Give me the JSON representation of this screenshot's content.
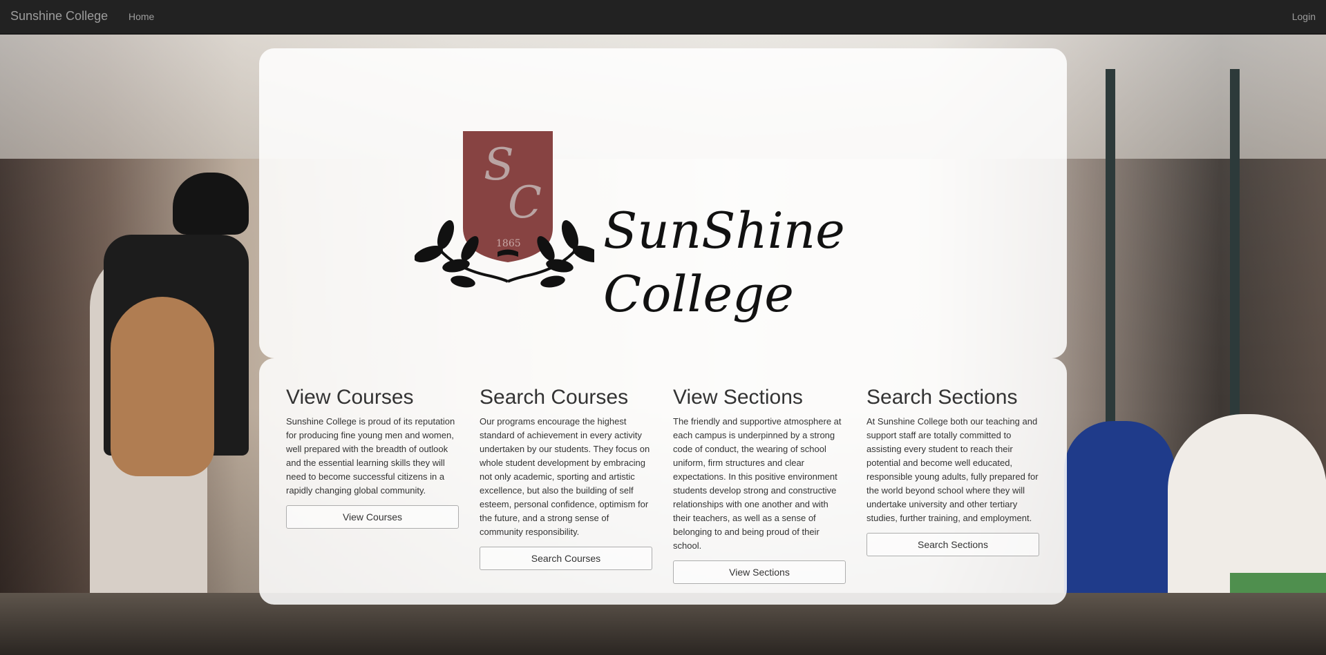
{
  "navbar": {
    "brand": "Sunshine College",
    "home": "Home",
    "login": "Login"
  },
  "hero": {
    "logo_initials_top": "S",
    "logo_initials_bottom": "C",
    "logo_year": "1865",
    "name_line1": "SunShine",
    "name_line2": "College"
  },
  "colors": {
    "navbar_bg": "#222222",
    "crest_fill": "#7a2f2d"
  },
  "sections": [
    {
      "title": "View Courses",
      "text": "Sunshine College is proud of its reputation for producing fine young men and women, well prepared with the breadth of outlook and the essential learning skills they will need to become successful citizens in a rapidly changing global community.",
      "button": "View Courses"
    },
    {
      "title": "Search Courses",
      "text": "Our programs encourage the highest standard of achievement in every activity undertaken by our students. They focus on whole student development by embracing not only academic, sporting and artistic excellence, but also the building of self esteem, personal confidence, optimism for the future, and a strong sense of community responsibility.",
      "button": "Search Courses"
    },
    {
      "title": "View Sections",
      "text": "The friendly and supportive atmosphere at each campus is underpinned by a strong code of conduct, the wearing of school uniform, firm structures and clear expectations. In this positive environment students develop strong and constructive relationships with one another and with their teachers, as well as a sense of belonging to and being proud of their school.",
      "button": "View Sections"
    },
    {
      "title": "Search Sections",
      "text": "At Sunshine College both our teaching and support staff are totally committed to assisting every student to reach their potential and become well educated, responsible young adults, fully prepared for the world beyond school where they will undertake university and other tertiary studies, further training, and employment.",
      "button": "Search Sections"
    }
  ]
}
